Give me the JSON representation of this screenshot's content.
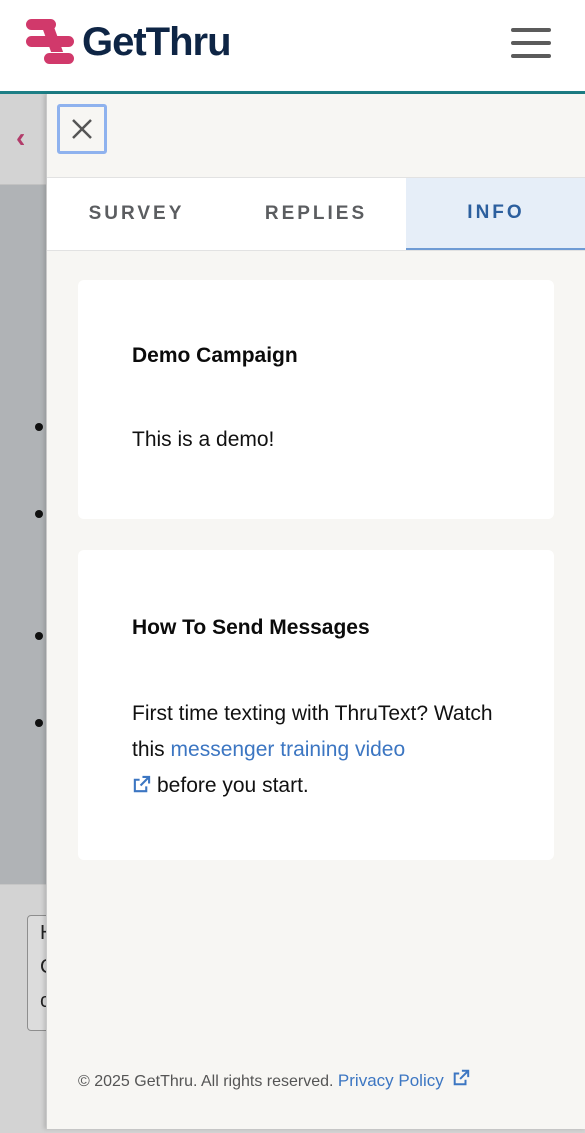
{
  "header": {
    "logo_text": "GetThru",
    "menu_icon": "hamburger-menu-icon"
  },
  "background": {
    "back_icon": "chevron-left-icon",
    "textarea_lines": [
      "H",
      "C",
      "c"
    ]
  },
  "drawer": {
    "close_icon": "close-icon",
    "tabs": [
      {
        "label": "SURVEY",
        "active": false
      },
      {
        "label": "REPLIES",
        "active": false
      },
      {
        "label": "INFO",
        "active": true
      }
    ],
    "cards": [
      {
        "title": "Demo Campaign",
        "body": "This is a demo!"
      },
      {
        "title": "How To Send Messages",
        "body_prefix": "First time texting with ThruText? Watch this",
        "link_text": "messenger training video",
        "link_icon": "external-link-icon",
        "body_suffix": "before you start."
      }
    ],
    "footer": {
      "copyright": "© 2025 GetThru. All rights reserved.",
      "privacy_link": "Privacy Policy",
      "privacy_icon": "external-link-icon"
    }
  },
  "colors": {
    "brand_pink": "#d1396b",
    "brand_navy": "#0e2545",
    "accent_teal": "#1d7f86",
    "link_blue": "#3c76c2",
    "active_tab_bg": "#e6eef8"
  }
}
